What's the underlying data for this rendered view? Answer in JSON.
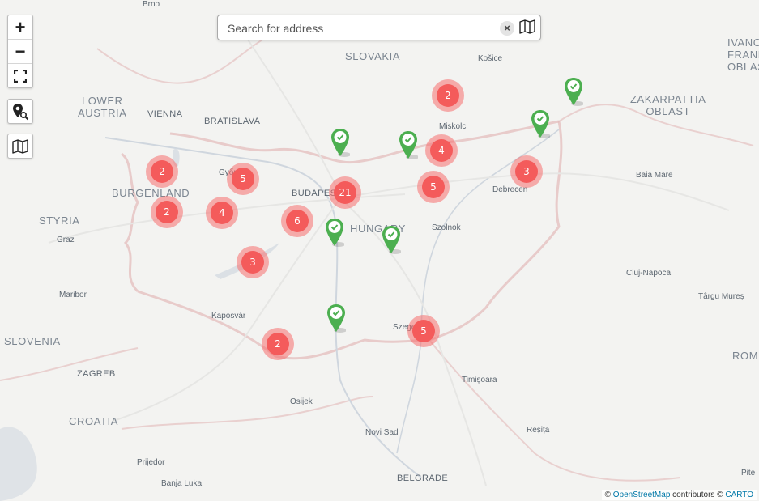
{
  "search": {
    "placeholder": "Search for address",
    "clear_glyph": "×"
  },
  "controls": {
    "zoom_in": "+",
    "zoom_out": "−"
  },
  "regions": {
    "slovakia": "SLOVAKIA",
    "lower_austria": "LOWER\nAUSTRIA",
    "burgenland": "BURGENLAND",
    "styria": "STYRIA",
    "slovenia": "SLOVENIA",
    "zakarpattia": "ZAKARPATTIA\nOBLAST",
    "ivano": "IVANO\nFRANKIV\nOBLAS",
    "croatia": "CROATIA",
    "hungary": "HUNGARY",
    "rom": "ROM"
  },
  "cities": {
    "vienna": "VIENNA",
    "bratislava": "BRATISLAVA",
    "budapest": "BUDAPEST",
    "zagreb": "ZAGREB",
    "belgrade": "BELGRADE",
    "brno": "Brno",
    "kosice": "Košice",
    "miskolc": "Miskolc",
    "debrecen": "Debrecen",
    "baia_mare": "Baia Mare",
    "szolnok": "Szolnok",
    "graz": "Graz",
    "gyor": "Győr",
    "maribor": "Maribor",
    "kaposvar": "Kaposvár",
    "cluj": "Cluj-Napoca",
    "targu_mures": "Târgu Mureș",
    "szeged": "Szeged",
    "timisoara": "Timișoara",
    "osijek": "Osijek",
    "novi_sad": "Novi Sad",
    "resita": "Reșița",
    "prijedor": "Prijedor",
    "banja_luka": "Banja Luka",
    "pite": "Pite"
  },
  "clusters": [
    {
      "label": "2"
    },
    {
      "label": "2"
    },
    {
      "label": "4"
    },
    {
      "label": "5"
    },
    {
      "label": "3"
    },
    {
      "label": "2"
    },
    {
      "label": "2"
    },
    {
      "label": "5"
    },
    {
      "label": "4"
    },
    {
      "label": "21"
    },
    {
      "label": "6"
    },
    {
      "label": "3"
    },
    {
      "label": "5"
    }
  ],
  "attribution": {
    "copyright": "©",
    "osm": "OpenStreetMap",
    "contributors": "contributors ©",
    "carto": "CARTO"
  },
  "colors": {
    "cluster": "#f45b5b",
    "marker": "#4caf50",
    "border": "#e8b4b4"
  }
}
